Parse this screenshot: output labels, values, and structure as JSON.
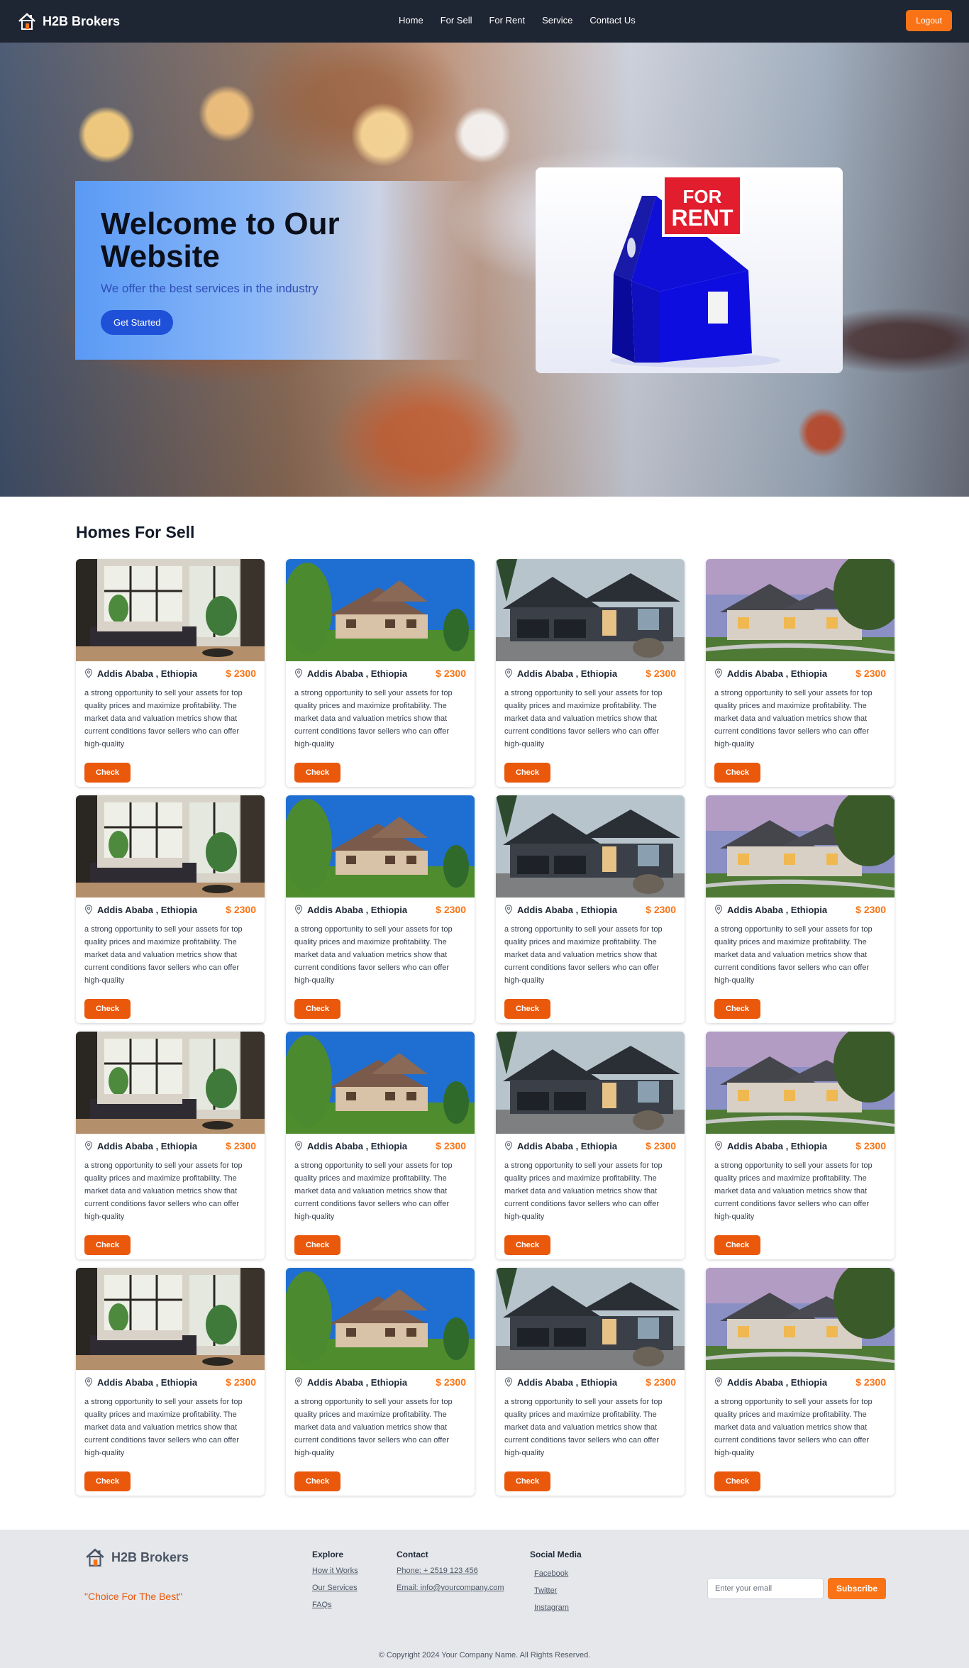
{
  "nav": {
    "brand": "H2B Brokers",
    "links": [
      "Home",
      "For Sell",
      "For Rent",
      "Service",
      "Contact Us"
    ],
    "logout": "Logout"
  },
  "hero": {
    "title": "Welcome to Our Website",
    "subtitle": "We offer the best services in the industry",
    "cta": "Get Started",
    "sign_line1": "FOR",
    "sign_line2": "RENT"
  },
  "listings": {
    "title": "Homes For Sell",
    "check_label": "Check",
    "location": "Addis Ababa , Ethiopia",
    "price": "$ 2300",
    "description": "a strong opportunity to sell your assets for top quality prices and maximize profitability. The market data and valuation metrics show that current conditions favor sellers who can offer high-quality",
    "photo_types": [
      "interior-living-room",
      "brick-house-blue-sky",
      "dark-modern-house",
      "stone-house-dusk"
    ]
  },
  "footer": {
    "brand": "H2B Brokers",
    "slogan": "\"Choice For The Best\"",
    "explore": {
      "heading": "Explore",
      "links": [
        "How it Works",
        "Our Services",
        "FAQs"
      ]
    },
    "contact": {
      "heading": "Contact",
      "phone": "Phone: + 2519 123 456",
      "email": "Email: info@yourcompany.com"
    },
    "social": {
      "heading": "Social Media",
      "links": [
        "Facebook",
        "Twitter",
        "Instagram"
      ]
    },
    "email_placeholder": "Enter your email",
    "subscribe": "Subscribe",
    "copyright": "© Copyright 2024 Your Company Name. All Rights Reserved."
  },
  "colors": {
    "accent": "#f97316",
    "nav_bg": "#1e2533",
    "hero_btn": "#1e50d8",
    "footer_bg": "#e5e7eb"
  }
}
